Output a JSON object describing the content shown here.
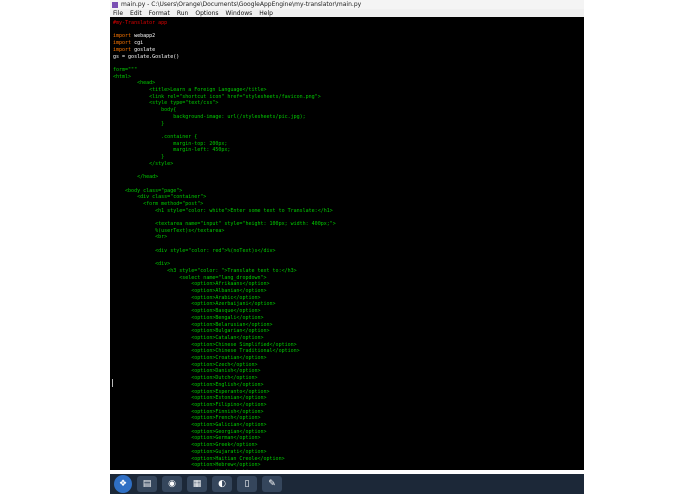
{
  "window": {
    "title": "main.py - C:\\Users\\Orange\\Documents\\GoogleAppEngine\\my-translator\\main.py",
    "menu": [
      "File",
      "Edit",
      "Format",
      "Run",
      "Options",
      "Windows",
      "Help"
    ]
  },
  "colors": {
    "keyword": "#ff7700",
    "string": "#00cc00",
    "plain": "#ffffff",
    "comment": "#dd0000",
    "background": "#000000"
  },
  "editor": {
    "lines": [
      {
        "c": "comment",
        "t": "#my-Translator app"
      },
      {
        "c": "plain",
        "t": ""
      },
      {
        "c": "mixed",
        "kw": "import",
        "t": " webapp2"
      },
      {
        "c": "mixed",
        "kw": "import",
        "t": " cgi"
      },
      {
        "c": "mixed",
        "kw": "import",
        "t": " goslate"
      },
      {
        "c": "plain",
        "t": "gs = goslate.Goslate()"
      },
      {
        "c": "plain",
        "t": ""
      },
      {
        "c": "form",
        "t": "form=\"\"\""
      },
      {
        "c": "string",
        "t": "<html>"
      },
      {
        "c": "string",
        "t": "        <head>"
      },
      {
        "c": "string",
        "t": "            <title>Learn a Foreign Language</title>"
      },
      {
        "c": "string",
        "t": "            <link rel=\"shortcut icon\" href=\"stylesheets/favicon.png\">"
      },
      {
        "c": "string",
        "t": "            <style type=\"text/css\">"
      },
      {
        "c": "string",
        "t": "                body{"
      },
      {
        "c": "string",
        "t": "                    background-image: url(/stylesheets/pic.jpg);"
      },
      {
        "c": "string",
        "t": "                }"
      },
      {
        "c": "string",
        "t": ""
      },
      {
        "c": "string",
        "t": "                .container {"
      },
      {
        "c": "string",
        "t": "                    margin-top: 200px;"
      },
      {
        "c": "string",
        "t": "                    margin-left: 450px;"
      },
      {
        "c": "string",
        "t": "                }"
      },
      {
        "c": "string",
        "t": "            </style>"
      },
      {
        "c": "string",
        "t": ""
      },
      {
        "c": "string",
        "t": "        </head>"
      },
      {
        "c": "string",
        "t": ""
      },
      {
        "c": "string",
        "t": "    <body class=\"page\">"
      },
      {
        "c": "string",
        "t": "        <div class=\"container\">"
      },
      {
        "c": "string",
        "t": "          <form method=\"post\">"
      },
      {
        "c": "string",
        "t": "              <h1 style=\"color: white\">Enter some text to Translate:</h1>"
      },
      {
        "c": "string",
        "t": ""
      },
      {
        "c": "string",
        "t": "              <textarea name=\"input\" style=\"height: 100px; width: 400px;\">"
      },
      {
        "c": "string",
        "t": "              %(userText)s</textarea>"
      },
      {
        "c": "string",
        "t": "              <br>"
      },
      {
        "c": "string",
        "t": ""
      },
      {
        "c": "string",
        "t": "              <div style=\"color: red\">%(noText)s</div>"
      },
      {
        "c": "string",
        "t": ""
      },
      {
        "c": "string",
        "t": "              <div>"
      },
      {
        "c": "string",
        "t": "                  <h3 style=\"color: \">Translate text to:</h3>"
      },
      {
        "c": "string",
        "t": "                      <select name=\"lang_dropdown\">"
      },
      {
        "c": "string",
        "t": "                          <option>Afrikaans</option>"
      },
      {
        "c": "string",
        "t": "                          <option>Albanian</option>"
      },
      {
        "c": "string",
        "t": "                          <option>Arabic</option>"
      },
      {
        "c": "string",
        "t": "                          <option>Azerbaijani</option>"
      },
      {
        "c": "string",
        "t": "                          <option>Basque</option>"
      },
      {
        "c": "string",
        "t": "                          <option>Bengali</option>"
      },
      {
        "c": "string",
        "t": "                          <option>Belarusian</option>"
      },
      {
        "c": "string",
        "t": "                          <option>Bulgarian</option>"
      },
      {
        "c": "string",
        "t": "                          <option>Catalan</option>"
      },
      {
        "c": "string",
        "t": "                          <option>Chinese Simplified</option>"
      },
      {
        "c": "string",
        "t": "                          <option>Chinese Traditional</option>"
      },
      {
        "c": "string",
        "t": "                          <option>Croatian</option>"
      },
      {
        "c": "string",
        "t": "                          <option>Czech</option>"
      },
      {
        "c": "string",
        "t": "                          <option>Danish</option>"
      },
      {
        "c": "string",
        "t": "                          <option>Dutch</option>"
      },
      {
        "c": "string",
        "t": "                          <option>English</option>"
      },
      {
        "c": "string",
        "t": "                          <option>Esperanto</option>"
      },
      {
        "c": "string",
        "t": "                          <option>Estonian</option>"
      },
      {
        "c": "string",
        "t": "                          <option>Filipino</option>"
      },
      {
        "c": "string",
        "t": "                          <option>Finnish</option>"
      },
      {
        "c": "string",
        "t": "                          <option>French</option>"
      },
      {
        "c": "string",
        "t": "                          <option>Galician</option>"
      },
      {
        "c": "string",
        "t": "                          <option>Georgian</option>"
      },
      {
        "c": "string",
        "t": "                          <option>German</option>"
      },
      {
        "c": "string",
        "t": "                          <option>Greek</option>"
      },
      {
        "c": "string",
        "t": "                          <option>Gujarati</option>"
      },
      {
        "c": "string",
        "t": "                          <option>Haitian Creole</option>"
      },
      {
        "c": "string",
        "t": "                          <option>Hebrew</option>"
      },
      {
        "c": "string",
        "t": "                          <option>Hindi</option>"
      }
    ]
  },
  "taskbar": {
    "icons": [
      "start-orb-icon",
      "libraries-icon",
      "chrome-icon",
      "explorer-icon",
      "idle-icon",
      "document-icon",
      "python-shell-icon"
    ]
  }
}
